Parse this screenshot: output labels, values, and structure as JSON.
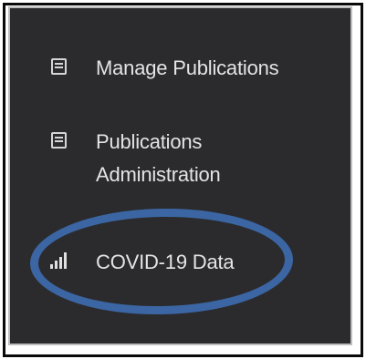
{
  "sidebar": {
    "items": [
      {
        "label": "Manage Publications",
        "icon": "document-icon"
      },
      {
        "label_line1": "Publications",
        "label_line2": "Administration",
        "icon": "document-icon"
      },
      {
        "label": "COVID-19 Data",
        "icon": "bar-chart-icon"
      }
    ]
  },
  "highlight_color": "#3b66a3",
  "panel_color": "#2b2b2e"
}
